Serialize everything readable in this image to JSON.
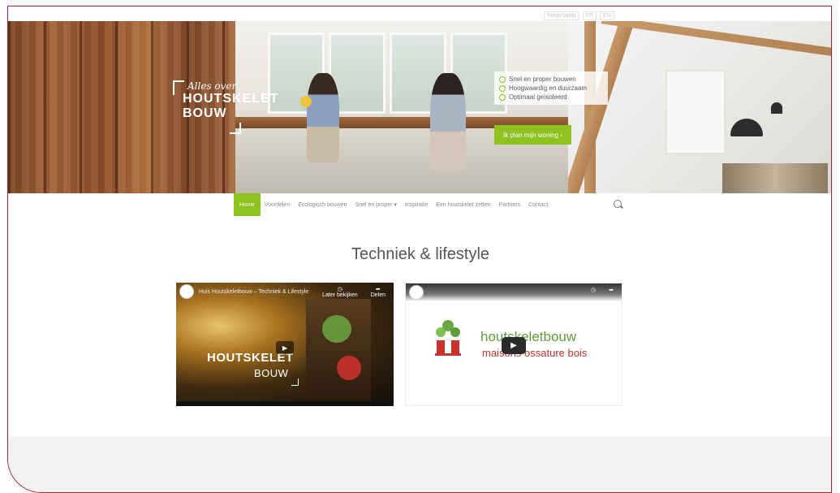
{
  "hero": {
    "welcome_prefix": "Alles over",
    "brand_line1": "HOUTSKELET",
    "brand_line2": "BOUW",
    "features": [
      "Snel en proper bouwen",
      "Hoogwaardig en duurzaam",
      "Optimaal geïsoleerd"
    ],
    "cta_label": "Ik plan mijn woning ›"
  },
  "lang": [
    "Nederlands",
    "FR",
    "EN"
  ],
  "nav": {
    "items": [
      "Home",
      "Voordelen",
      "Ecologisch bouwen",
      "Snel en proper ▾",
      "Inspiratie",
      "Een houtskelet zetten",
      "Partners",
      "Contact"
    ]
  },
  "heading": "Techniek & lifestyle",
  "videos": [
    {
      "title": "Huis Houtskeletbouw – Techniek & Lifestyle",
      "watch_later": "Later bekijken",
      "share": "Delen",
      "logo_line1": "HOUTSKELET",
      "logo_line2": "BOUW",
      "play": "▶"
    },
    {
      "title": "",
      "brand_line1": "houtskeletbouw",
      "brand_line2": "maisons ossature bois",
      "play": "▶"
    }
  ],
  "icons": {
    "search": "search-icon",
    "clock": "clock-icon",
    "share": "share-icon"
  },
  "colors": {
    "accent": "#8dc21f",
    "frame": "#b1202c",
    "brand_red": "#c9322b",
    "brand_green": "#5f9c3a"
  }
}
